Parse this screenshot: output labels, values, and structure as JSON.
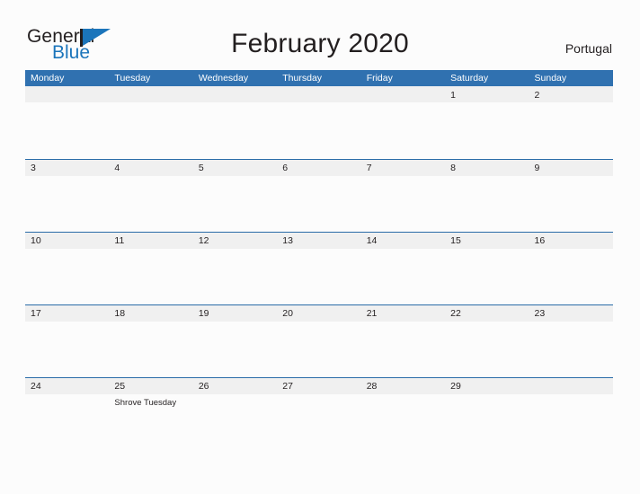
{
  "brand": {
    "name_part1": "General",
    "name_part2": "Blue",
    "flag_icon": "flag-triangle-icon",
    "accent_color": "#1b75bb"
  },
  "header": {
    "title": "February 2020",
    "region": "Portugal"
  },
  "theme": {
    "header_blue": "#3071b0",
    "row_line_blue": "#2a6ca8",
    "row_band_gray": "#f0f0f0",
    "page_background": "#fcfcfc",
    "text_color": "#231f20"
  },
  "calendar": {
    "month": "February",
    "year": "2020",
    "weekday_headers": [
      "Monday",
      "Tuesday",
      "Wednesday",
      "Thursday",
      "Friday",
      "Saturday",
      "Sunday"
    ],
    "weeks": [
      {
        "days": [
          {
            "number": "",
            "event": ""
          },
          {
            "number": "",
            "event": ""
          },
          {
            "number": "",
            "event": ""
          },
          {
            "number": "",
            "event": ""
          },
          {
            "number": "",
            "event": ""
          },
          {
            "number": "1",
            "event": ""
          },
          {
            "number": "2",
            "event": ""
          }
        ]
      },
      {
        "days": [
          {
            "number": "3",
            "event": ""
          },
          {
            "number": "4",
            "event": ""
          },
          {
            "number": "5",
            "event": ""
          },
          {
            "number": "6",
            "event": ""
          },
          {
            "number": "7",
            "event": ""
          },
          {
            "number": "8",
            "event": ""
          },
          {
            "number": "9",
            "event": ""
          }
        ]
      },
      {
        "days": [
          {
            "number": "10",
            "event": ""
          },
          {
            "number": "11",
            "event": ""
          },
          {
            "number": "12",
            "event": ""
          },
          {
            "number": "13",
            "event": ""
          },
          {
            "number": "14",
            "event": ""
          },
          {
            "number": "15",
            "event": ""
          },
          {
            "number": "16",
            "event": ""
          }
        ]
      },
      {
        "days": [
          {
            "number": "17",
            "event": ""
          },
          {
            "number": "18",
            "event": ""
          },
          {
            "number": "19",
            "event": ""
          },
          {
            "number": "20",
            "event": ""
          },
          {
            "number": "21",
            "event": ""
          },
          {
            "number": "22",
            "event": ""
          },
          {
            "number": "23",
            "event": ""
          }
        ]
      },
      {
        "days": [
          {
            "number": "24",
            "event": ""
          },
          {
            "number": "25",
            "event": "Shrove Tuesday"
          },
          {
            "number": "26",
            "event": ""
          },
          {
            "number": "27",
            "event": ""
          },
          {
            "number": "28",
            "event": ""
          },
          {
            "number": "29",
            "event": ""
          },
          {
            "number": "",
            "event": ""
          }
        ]
      }
    ]
  }
}
